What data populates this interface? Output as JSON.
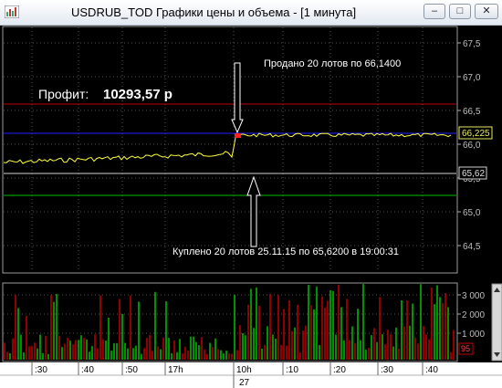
{
  "window": {
    "title": "USDRUB_TOD Графики цены и объема - [1 минута]"
  },
  "colors": {
    "price_line": "#ffff40",
    "red_level": "#c00000",
    "blue_level": "#2020ff",
    "white_level": "#d0d0d0",
    "green_level": "#00c000",
    "volume_up": "#00c000",
    "volume_down": "#c00000",
    "grid": "#606060"
  },
  "price_panel": {
    "profit_label": "Профит:",
    "profit_value": "10293,57 р",
    "sell_annotation": "Продано 20 лотов по 66,1400",
    "buy_annotation": "Куплено 20 лотов 25.11.15 по 65,6200 в 19:00:31",
    "y_ticks": [
      "67,5",
      "67,0",
      "66,5",
      "66,0",
      "65,5",
      "65,0",
      "64,5"
    ],
    "last_price_tag": "66,225",
    "buy_price_tag": "65,62"
  },
  "volume_panel": {
    "y_ticks": [
      "3 000",
      "2 000",
      "1 000"
    ],
    "last_volume_tag": "95"
  },
  "time_axis": {
    "labels": [
      ":30",
      ":40",
      ":50",
      "17h",
      "10h",
      ":10",
      ":20",
      ":30",
      ":40"
    ],
    "date_label": "27"
  }
}
